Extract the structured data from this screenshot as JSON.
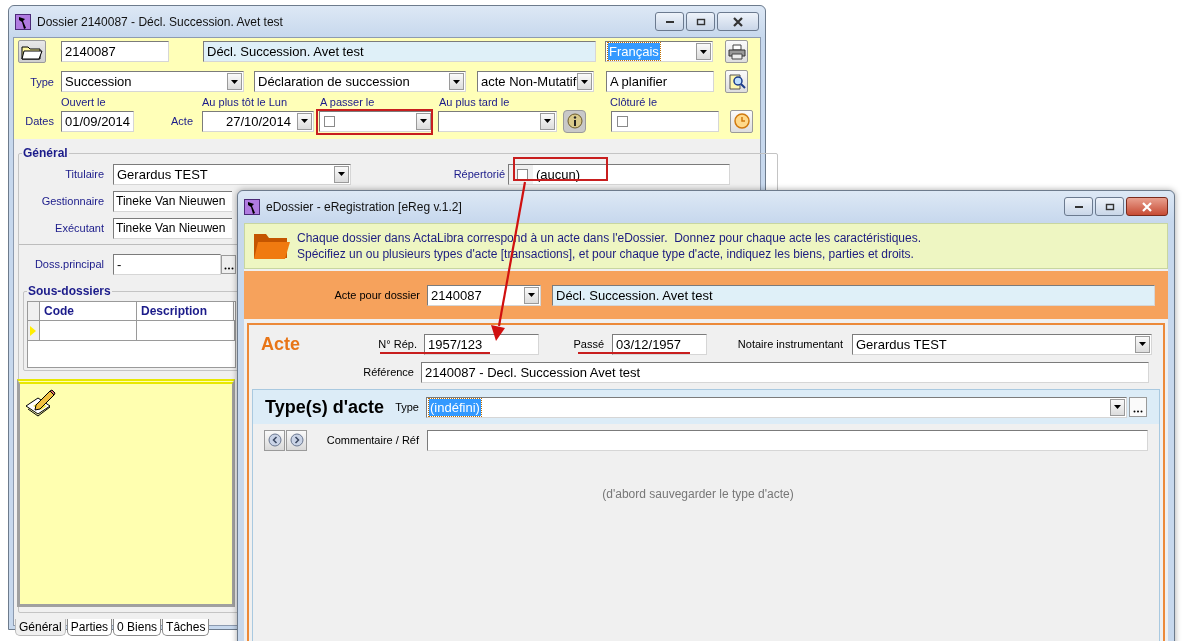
{
  "back_window": {
    "title": "Dossier 2140087 - Décl. Succession. Avet test",
    "header": {
      "number": "2140087",
      "description": "Décl. Succession. Avet test",
      "language": {
        "value": "Français",
        "focused": true
      },
      "type_label": "Type",
      "type": "Succession",
      "subtype": "Déclaration de succession",
      "category": "acte Non-Mutatif",
      "status": "A planifier",
      "dates_label": "Dates",
      "opened_label": "Ouvert le",
      "opened": "01/09/2014",
      "acte_label": "Acte",
      "earliest_label": "Au plus tôt le Lun",
      "earliest": "27/10/2014",
      "pass_label": "A passer le",
      "pass_checked": false,
      "latest_label": "Au plus tard le",
      "closed_label": "Clôturé le",
      "closed_checked": false
    },
    "general": {
      "title": "Général",
      "holder_label": "Titulaire",
      "holder": "Gerardus TEST",
      "repertoire_label": "Répertorié",
      "repertoire_checked": false,
      "repertoire": "(aucun)",
      "manager_label": "Gestionnaire",
      "manager": "Tineke Van Nieuwen",
      "executor_label": "Exécutant",
      "executor": "Tineke Van Nieuwen",
      "parent_label": "Doss.principal",
      "parent": "-"
    },
    "subfolders": {
      "title": "Sous-dossiers",
      "columns": [
        "Code",
        "Description"
      ]
    },
    "tabs": [
      {
        "label": "Général",
        "selected": true
      },
      {
        "label": "Parties",
        "selected": false
      },
      {
        "label": "0 Biens",
        "selected": false
      },
      {
        "label": "Tâches",
        "selected": false
      }
    ]
  },
  "front_window": {
    "title": "eDossier - eRegistration [eReg v.1.2]",
    "info_lines": [
      "Chaque dossier dans ActaLibra correspond à un acte dans l'eDossier.  Donnez pour chaque acte les caractéristiques.",
      "Spécifiez un ou plusieurs types d'acte [transactions], et pour chaque type d'acte, indiquez les biens, parties et droits."
    ],
    "dossier_label": "Acte pour dossier",
    "dossier": "2140087",
    "dossier_description": "Décl. Succession. Avet test",
    "acte": {
      "title": "Acte",
      "rep_label": "N° Rép.",
      "rep": "1957/123",
      "passed_label": "Passé",
      "passed": "03/12/1957",
      "notary_label": "Notaire instrumentant",
      "notary": "Gerardus TEST",
      "reference_label": "Référence",
      "reference": "2140087 - Decl. Succession Avet test"
    },
    "act_types": {
      "title": "Type(s) d'acte",
      "type_label": "Type",
      "type": {
        "value": "(indéfini)",
        "focused": true
      },
      "comment_label": "Commentaire / Réf",
      "hint": "(d'abord sauvegarder le type d'acte)"
    }
  }
}
